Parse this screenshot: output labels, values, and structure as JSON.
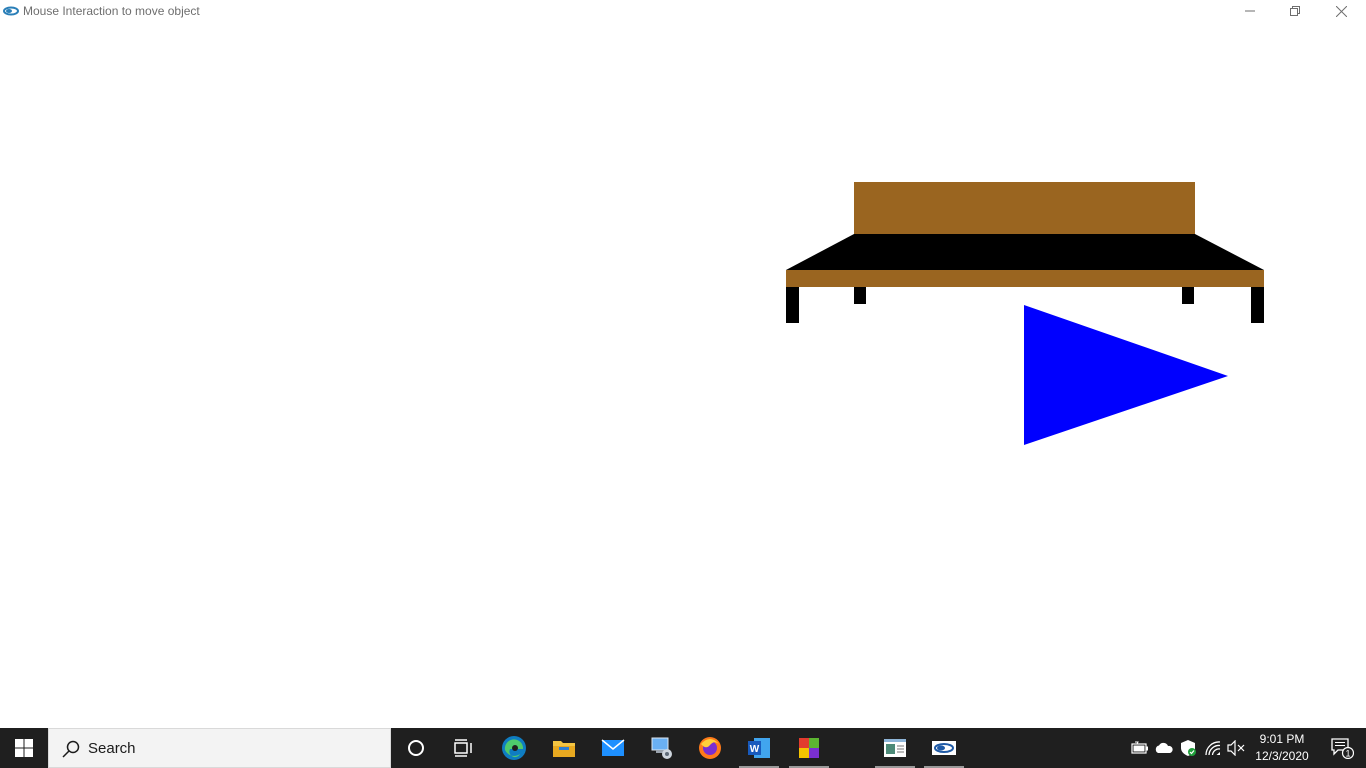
{
  "window": {
    "title": "Mouse Interaction to move object",
    "controls": {
      "minimize_icon": "minimize-icon",
      "maximize_icon": "restore-icon",
      "close_icon": "close-icon"
    }
  },
  "scene": {
    "objects": [
      {
        "name": "bench",
        "colors": {
          "wood": "#9a6520",
          "seat": "#000000",
          "legs": "#000000"
        }
      },
      {
        "name": "triangle",
        "color": "#0000ff"
      }
    ]
  },
  "taskbar": {
    "search": {
      "placeholder": "Search"
    },
    "pinned": [
      {
        "name": "cortana-icon"
      },
      {
        "name": "task-view-icon"
      },
      {
        "name": "edge-icon"
      },
      {
        "name": "file-explorer-icon"
      },
      {
        "name": "mail-icon"
      },
      {
        "name": "control-panel-icon"
      },
      {
        "name": "firefox-icon"
      },
      {
        "name": "word-icon"
      },
      {
        "name": "app-multicolor-icon"
      },
      {
        "name": "app-window-icon"
      },
      {
        "name": "app-opengl-icon"
      }
    ],
    "tray": {
      "icons": [
        "battery-icon",
        "onedrive-icon",
        "defender-icon",
        "wifi-icon",
        "volume-muted-icon"
      ],
      "time": "9:01 PM",
      "date": "12/3/2020",
      "notification_count": "1"
    }
  }
}
